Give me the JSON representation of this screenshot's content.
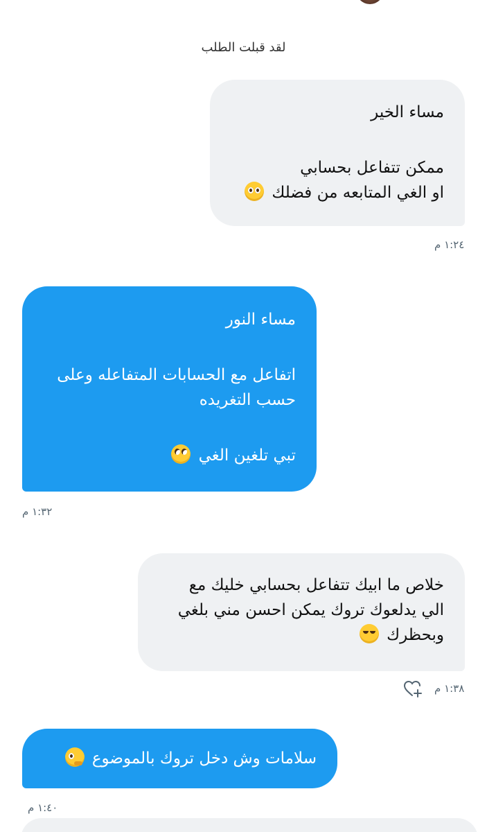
{
  "system_note": "لقد قبلت الطلب",
  "messages": [
    {
      "side": "sent",
      "lines": [
        "مساء الخير",
        "",
        "ممكن تتفاعل بحسابي",
        "او الغي المتابعه من فضلك"
      ],
      "emoji": "pleading-face-icon",
      "time": "١:٢٤ م"
    },
    {
      "side": "received",
      "lines": [
        "مساء النور",
        "",
        "اتفاعل مع الحسابات المتفاعله وعلى",
        "حسب التغريده",
        "",
        "تبي تلغين الغي"
      ],
      "emoji": "face-with-rolling-eyes-icon",
      "time": "١:٣٢ م"
    },
    {
      "side": "sent",
      "lines": [
        "خلاص ما ابيك تتفاعل بحسابي خليك مع",
        "الي يدلعوك تروك يمكن احسن مني بلغي",
        "وبحظرك"
      ],
      "emoji": "smiling-face-with-tear-icon",
      "time": "١:٣٨ م"
    },
    {
      "side": "received",
      "lines": [
        "سلامات وش دخل تروك بالموضوع"
      ],
      "emoji": "thinking-face-icon",
      "time": "١:٤٠ م"
    }
  ],
  "colors": {
    "received_bubble": "#1d9bf0",
    "sent_bubble": "#eff1f3",
    "timestamp": "#536471"
  }
}
